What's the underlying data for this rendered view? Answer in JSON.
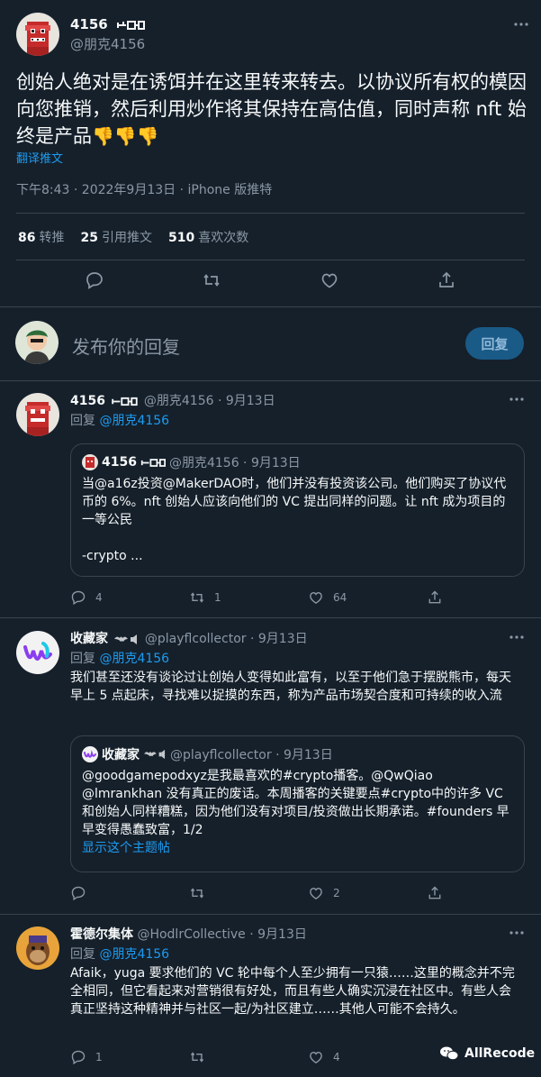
{
  "main": {
    "name": "4156",
    "handle": "@朋克4156",
    "text": "创始人绝对是在诱饵并在这里转来转去。以协议所有权的模因向您推销，然后利用炒作将其保持在高估值，同时声称 nft 始终是产品",
    "emoji": "👎👎👎",
    "translate": "翻译推文",
    "meta": "下午8:43 · 2022年9月13日 · iPhone 版推特",
    "stats": [
      {
        "count": "86",
        "label": "转推"
      },
      {
        "count": "25",
        "label": "引用推文"
      },
      {
        "count": "510",
        "label": "喜欢次数"
      }
    ]
  },
  "reply_bar": {
    "placeholder": "发布你的回复",
    "button": "回复"
  },
  "replies": [
    {
      "name": "4156",
      "handle": "@朋克4156 · 9月13日",
      "reply_to_label": "回复",
      "reply_to": "@朋克4156",
      "quote": {
        "name": "4156",
        "handle": "@朋克4156 · 9月13日",
        "text": "当@a16z投资@MakerDAO时，他们并没有投资该公司。他们购买了协议代币的 6%。nft 创始人应该向他们的 VC 提出同样的问题。让 nft 成为项目的一等公民",
        "text2": "-crypto ..."
      },
      "counts": {
        "reply": "4",
        "retweet": "1",
        "like": "64"
      }
    },
    {
      "name": "收藏家",
      "handle": "@playflcollector · 9月13日",
      "reply_to_label": "回复",
      "reply_to": "@朋克4156",
      "text": "我们甚至还没有谈论过让创始人变得如此富有，以至于他们急于摆脱熊市，每天早上 5 点起床，寻找难以捉摸的东西，称为产品市场契合度和可持续的收入流",
      "quote": {
        "name": "收藏家",
        "handle": "@playflcollector · 9月13日",
        "text": "@goodgamepodxyz是我最喜欢的#crypto播客。@QwQiao @lmrankhan 没有真正的废话。本周播客的关键要点#crypto中的许多 VC 和创始人同样糟糕，因为他们没有对项目/投资做出长期承诺。#founders 早早变得愚蠢致富，1/2",
        "thread_link": "显示这个主题帖"
      },
      "counts": {
        "reply": "",
        "retweet": "",
        "like": "2"
      }
    },
    {
      "name": "霍德尔集体",
      "handle": "@HodlrCollective · 9月13日",
      "reply_to_label": "回复",
      "reply_to": "@朋克4156",
      "text": "Afaik，yuga 要求他们的 VC 轮中每个人至少拥有一只猿……这里的概念并不完全相同，但它看起来对营销很有好处，而且有些人确实沉浸在社区中。有些人会真正坚持这种精神并与社区一起/为社区建立……其他人可能不会持久。",
      "counts": {
        "reply": "1",
        "retweet": "",
        "like": "4"
      }
    }
  ],
  "watermark": "AllRecode",
  "colors": {
    "background": "#15202b",
    "accent": "#1d9bf0",
    "muted": "#8b98a5",
    "border": "#38444d"
  }
}
